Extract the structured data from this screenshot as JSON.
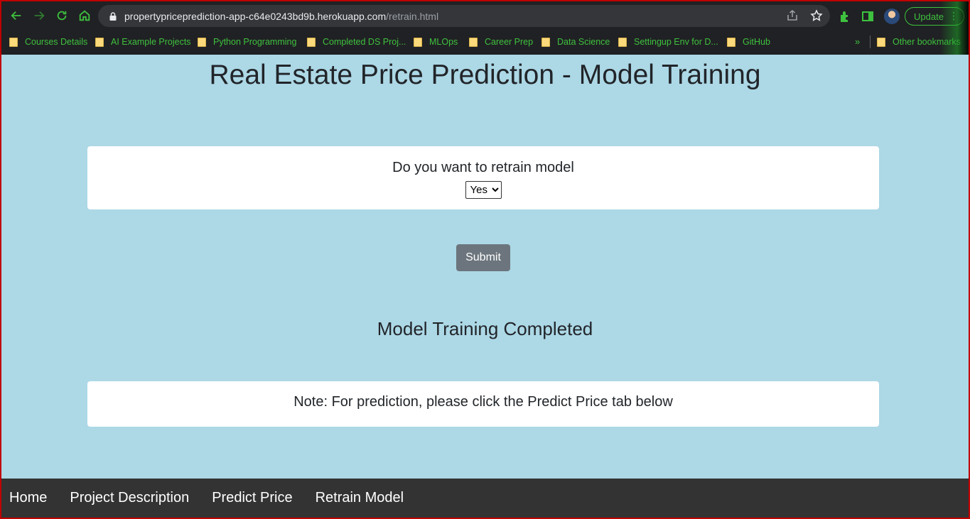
{
  "browser": {
    "url_host": "propertypriceprediction-app-c64e0243bd9b.herokuapp.com",
    "url_path": "/retrain.html",
    "update_label": "Update",
    "accent_color": "#3ec13e",
    "bookmarks": [
      {
        "label": "Courses Details"
      },
      {
        "label": "AI Example Projects"
      },
      {
        "label": "Python Programming"
      },
      {
        "label": "Completed DS Proj..."
      },
      {
        "label": "MLOps"
      },
      {
        "label": "Career Prep"
      },
      {
        "label": "Data Science"
      },
      {
        "label": "Settingup Env for D..."
      },
      {
        "label": "GitHub"
      }
    ],
    "more_label": "»",
    "other_bookmarks_label": "Other bookmarks"
  },
  "page": {
    "title": "Real Estate Price Prediction - Model Training",
    "background_color": "#add8e6",
    "retrain": {
      "question": "Do you want to retrain model",
      "selected": "Yes",
      "options": [
        "Yes"
      ]
    },
    "submit_label": "Submit",
    "status": "Model Training Completed",
    "note": "Note: For prediction, please click the Predict Price tab below"
  },
  "footer": {
    "links": [
      {
        "label": "Home"
      },
      {
        "label": "Project Description"
      },
      {
        "label": "Predict Price"
      },
      {
        "label": "Retrain Model"
      }
    ]
  }
}
